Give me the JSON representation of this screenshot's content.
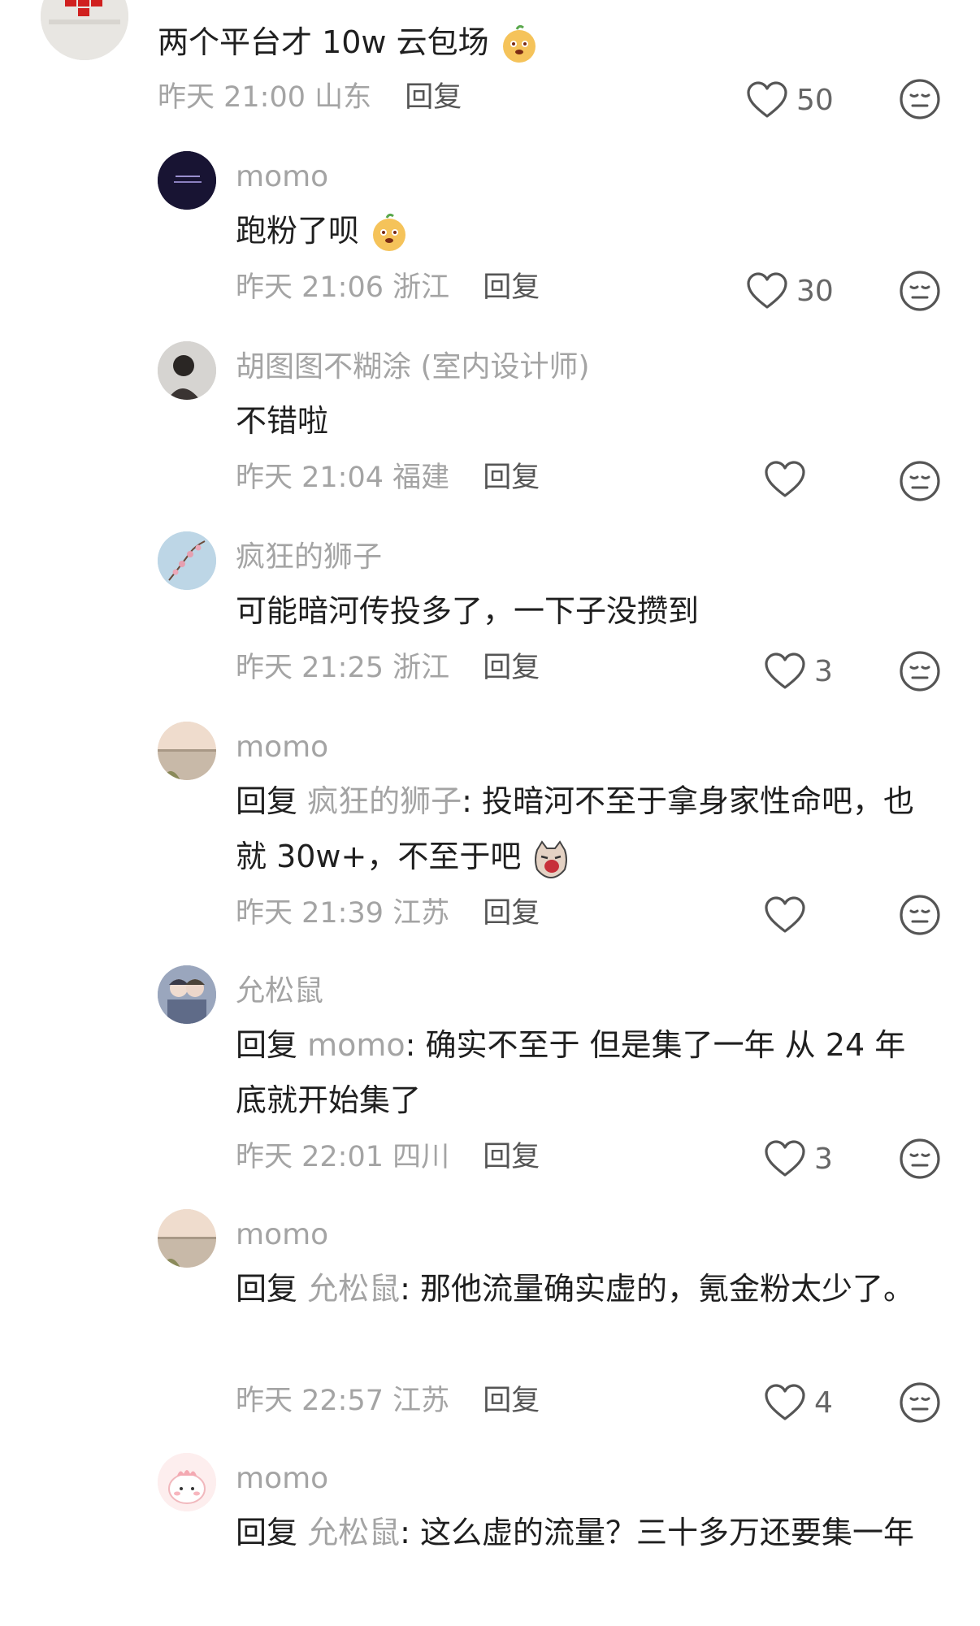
{
  "icons": {
    "like": "heart-outline-icon",
    "dislike": "neutral-face-icon"
  },
  "comments": [
    {
      "text": "两个平台才 10w 云包场",
      "time": "昨天 21:00",
      "location": "山东",
      "reply_label": "回复",
      "likes": "50"
    },
    {
      "name": "momo",
      "text": "跑粉了呗",
      "time": "昨天 21:06",
      "location": "浙江",
      "reply_label": "回复",
      "likes": "30"
    },
    {
      "name": "胡图图不糊涂 (室内设计师)",
      "text": "不错啦",
      "time": "昨天 21:04",
      "location": "福建",
      "reply_label": "回复",
      "likes": ""
    },
    {
      "name": "疯狂的狮子",
      "text": "可能暗河传投多了，一下子没攒到",
      "time": "昨天 21:25",
      "location": "浙江",
      "reply_label": "回复",
      "likes": "3"
    },
    {
      "name": "momo",
      "reply_prefix": "回复",
      "mention": "疯狂的狮子",
      "text": ": 投暗河不至于拿身家性命吧，也就 30w+，不至于吧",
      "time": "昨天 21:39",
      "location": "江苏",
      "reply_label": "回复",
      "likes": ""
    },
    {
      "name": "允松鼠",
      "reply_prefix": "回复",
      "mention": "momo",
      "text": ": 确实不至于 但是集了一年  从 24 年底就开始集了",
      "time": "昨天 22:01",
      "location": "四川",
      "reply_label": "回复",
      "likes": "3"
    },
    {
      "name": "momo",
      "reply_prefix": "回复",
      "mention": "允松鼠",
      "text": ": 那他流量确实虚的，氪金粉太少了。",
      "time": "昨天 22:57",
      "location": "江苏",
      "reply_label": "回复",
      "likes": "4"
    },
    {
      "name": "momo",
      "reply_prefix": "回复",
      "mention": "允松鼠",
      "text": ": 这么虚的流量？三十多万还要集一年",
      "time": "",
      "location": "",
      "reply_label": "",
      "likes": ""
    }
  ]
}
